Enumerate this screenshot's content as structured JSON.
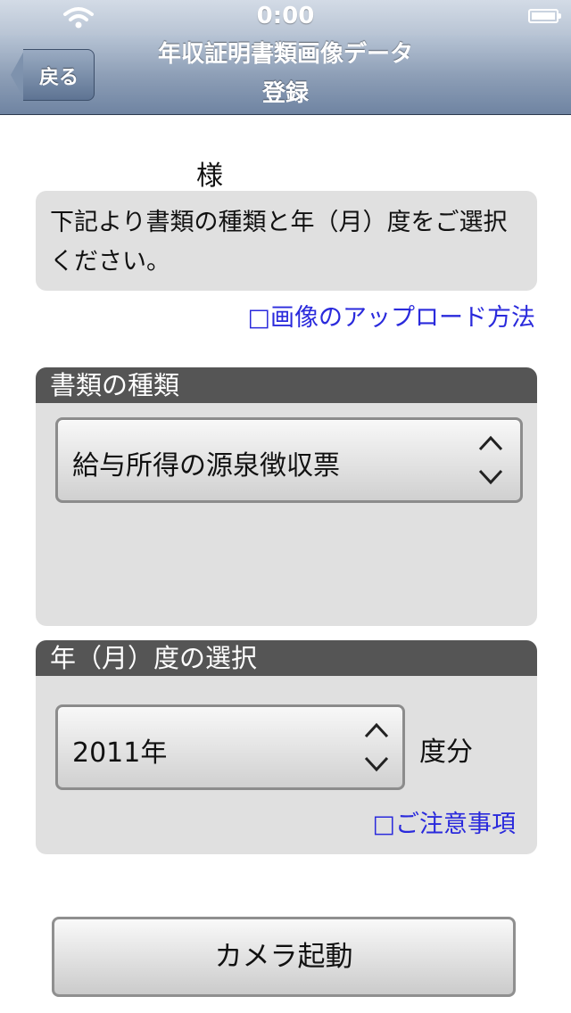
{
  "status_bar": {
    "time": "0:00",
    "wifi_icon": "wifi-icon",
    "battery_icon": "battery-icon"
  },
  "nav": {
    "back_label": "戻る",
    "title_line1": "年収証明書類画像データ",
    "title_line2": "登録"
  },
  "content": {
    "name_suffix": "様",
    "message": "下記より書類の種類と年（月）度をご選択ください。",
    "upload_link": "□画像のアップロード方法",
    "doc_section": {
      "header": "書類の種類",
      "selected": "給与所得の源泉徴収票"
    },
    "year_section": {
      "header": "年（月）度の選択",
      "selected": "2011年",
      "suffix": "度分",
      "caution_link": "□ご注意事項"
    },
    "camera_button": "カメラ起動"
  },
  "colors": {
    "link": "#2a2adc",
    "section_header": "#555555",
    "box_bg": "#e0e0e0",
    "nav_top": "#b6c3d4",
    "nav_bottom": "#6f84a2"
  }
}
